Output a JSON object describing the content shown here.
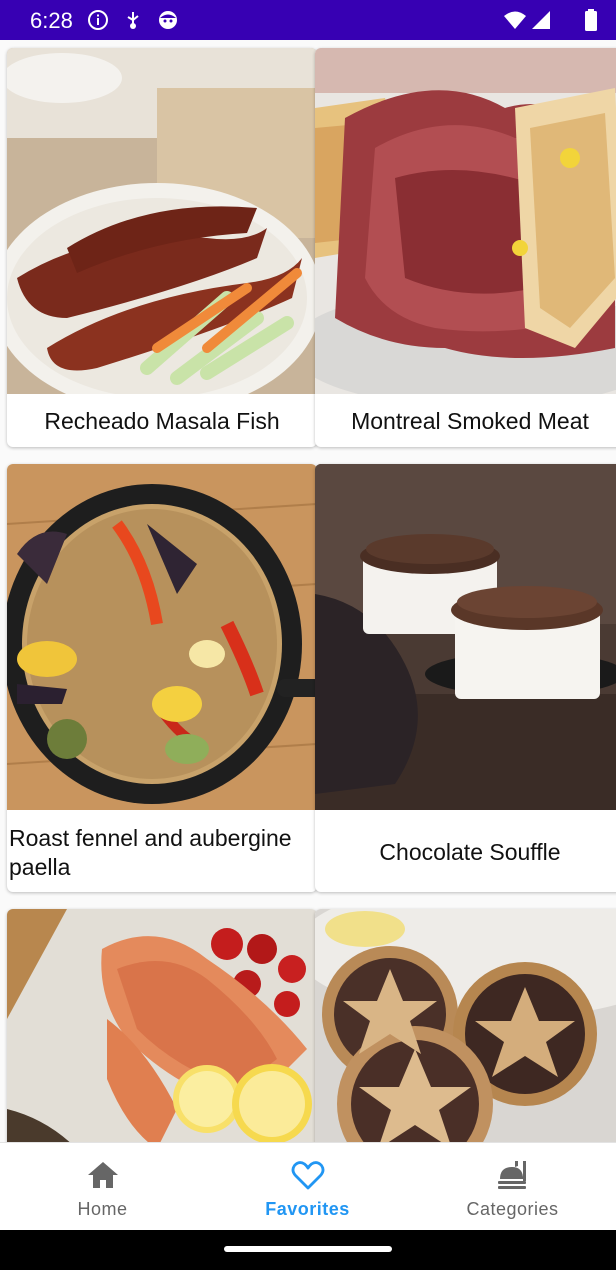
{
  "status_bar": {
    "time": "6:28",
    "icons": [
      "info-icon",
      "usb-icon",
      "face-icon",
      "wifi-icon",
      "signal-icon",
      "battery-icon"
    ]
  },
  "meals": [
    {
      "title": "Recheado Masala Fish"
    },
    {
      "title": "Montreal Smoked Meat"
    },
    {
      "title": "Roast fennel and aubergine paella"
    },
    {
      "title": "Chocolate Souffle"
    },
    {
      "title": ""
    },
    {
      "title": ""
    }
  ],
  "bottom_nav": {
    "items": [
      {
        "label": "Home",
        "icon": "home-icon"
      },
      {
        "label": "Favorites",
        "icon": "heart-icon"
      },
      {
        "label": "Categories",
        "icon": "food-tray-icon"
      }
    ],
    "active_index": 1,
    "active_color": "#2196F3",
    "inactive_color": "#666666"
  },
  "colors": {
    "status_bar": "#3700B3",
    "card_background": "#FFFFFF"
  }
}
